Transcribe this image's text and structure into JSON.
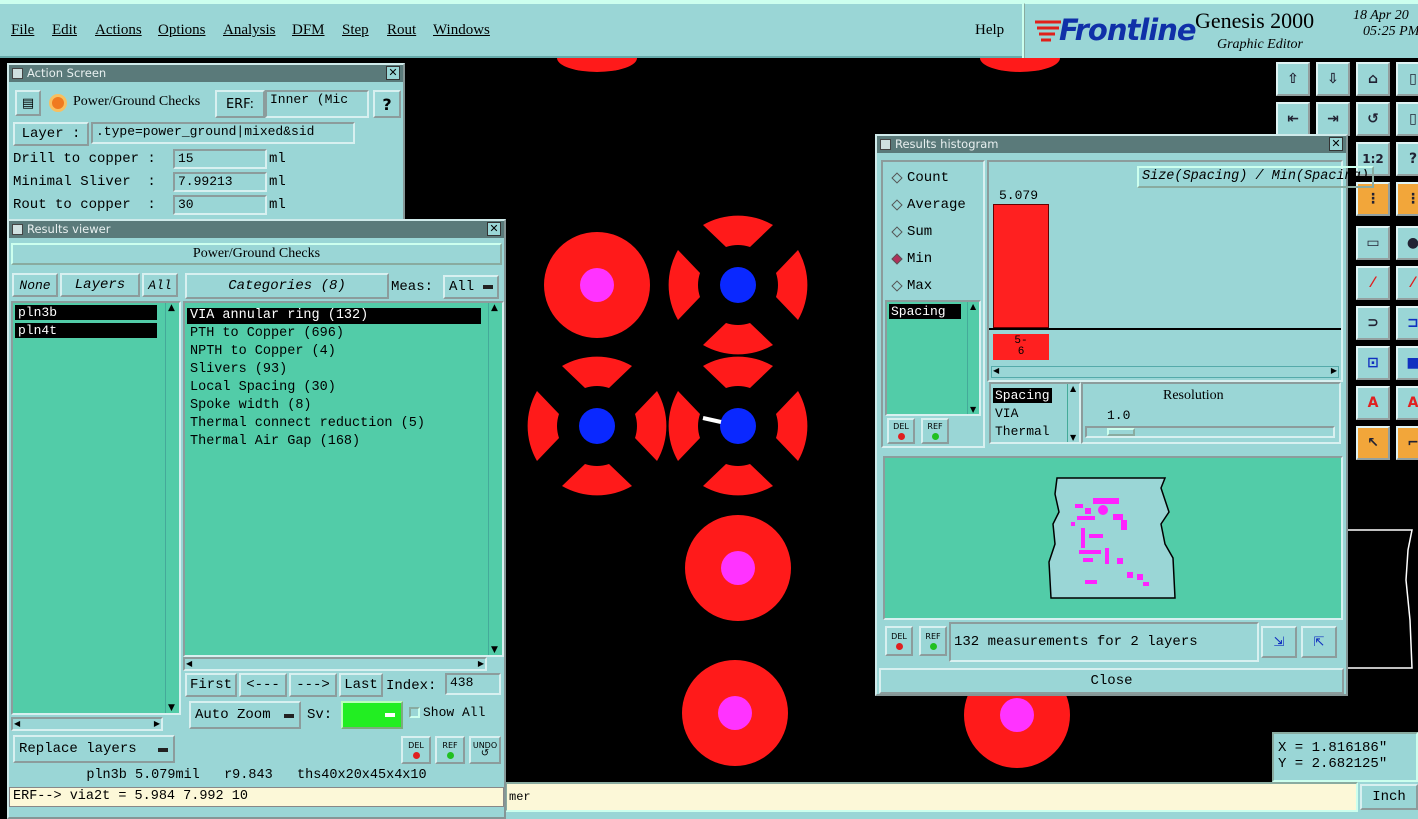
{
  "menubar": {
    "items": [
      "File",
      "Edit",
      "Actions",
      "Options",
      "Analysis",
      "DFM",
      "Step",
      "Rout",
      "Windows"
    ],
    "help": "Help"
  },
  "brand": {
    "logo": "Frontline",
    "product": "Genesis 2000",
    "subtitle": "Graphic Editor",
    "date": "18 Apr 20",
    "time": "05:25 PM"
  },
  "action_screen": {
    "title": "Action Screen",
    "check_name": "Power/Ground Checks",
    "erf_label": "ERF:",
    "erf_value": "Inner (Mic",
    "help_label": "?",
    "layer_label": "Layer :",
    "layer_value": ".type=power_ground|mixed&sid",
    "params": [
      {
        "label": "Drill to copper :",
        "value": "15",
        "unit": "ml"
      },
      {
        "label": "Minimal Sliver  :",
        "value": "7.99213",
        "unit": "ml"
      },
      {
        "label": "Rout to copper  :",
        "value": "30",
        "unit": "ml"
      }
    ]
  },
  "results_viewer": {
    "title": "Results viewer",
    "header": "Power/Ground Checks",
    "none_label": "None",
    "layers_label": "Layers",
    "all_label": "All",
    "layers": [
      "pln3b",
      "pln4t"
    ],
    "categories_label": "Categories (8)",
    "meas_label": "Meas:",
    "meas_value": "All",
    "categories": [
      "VIA annular ring (132)",
      "PTH to Copper (696)",
      "NPTH to Copper (4)",
      "Slivers (93)",
      "Local Spacing (30)",
      "Spoke width (8)",
      "Thermal connect reduction (5)",
      "Thermal Air Gap (168)"
    ],
    "first_label": "First",
    "prev_label": "<---",
    "next_label": "--->",
    "last_label": "Last",
    "index_label": "Index:",
    "index_value": "438",
    "auto_zoom_label": "Auto Zoom",
    "sv_label": "Sv:",
    "show_all_label": "Show All",
    "replace_layers_label": "Replace layers",
    "del_label": "DEL",
    "ref_label": "REF",
    "undo_label": "UNDO",
    "status_line": "pln3b 5.079mil   r9.843   ths40x20x45x4x10",
    "erf_line": "ERF--> via2t = 5.984 7.992 10"
  },
  "histogram": {
    "title": "Results histogram",
    "options": [
      {
        "label": "Count",
        "selected": false
      },
      {
        "label": "Average",
        "selected": false
      },
      {
        "label": "Sum",
        "selected": false
      },
      {
        "label": "Min",
        "selected": true
      },
      {
        "label": "Max",
        "selected": false
      }
    ],
    "list_item": "Spacing",
    "chart_title": "Size(Spacing) / Min(Spacing)",
    "bar_value_label": "5.079",
    "bin_label_a": "5-",
    "bin_label_b": "6",
    "bar_value": 5.079,
    "bar_color": "#ff2020",
    "types": [
      "Spacing",
      "VIA",
      "Thermal"
    ],
    "resolution_label": "Resolution",
    "resolution_value": "1.0",
    "measurements_text": "132 measurements for 2 layers",
    "close_label": "Close",
    "del_label": "DEL",
    "ref_label": "REF"
  },
  "coords": {
    "x": "X = 1.816186\"",
    "y": "Y = 2.682125\""
  },
  "bottom": {
    "message_fragment": "mer",
    "units": "Inch"
  },
  "colors": {
    "pad": "#ff1a1a",
    "hole_blue": "#0a28ff",
    "hole_magenta": "#ff33ff",
    "panel": "#9ad6d6",
    "list": "#52cca8"
  }
}
